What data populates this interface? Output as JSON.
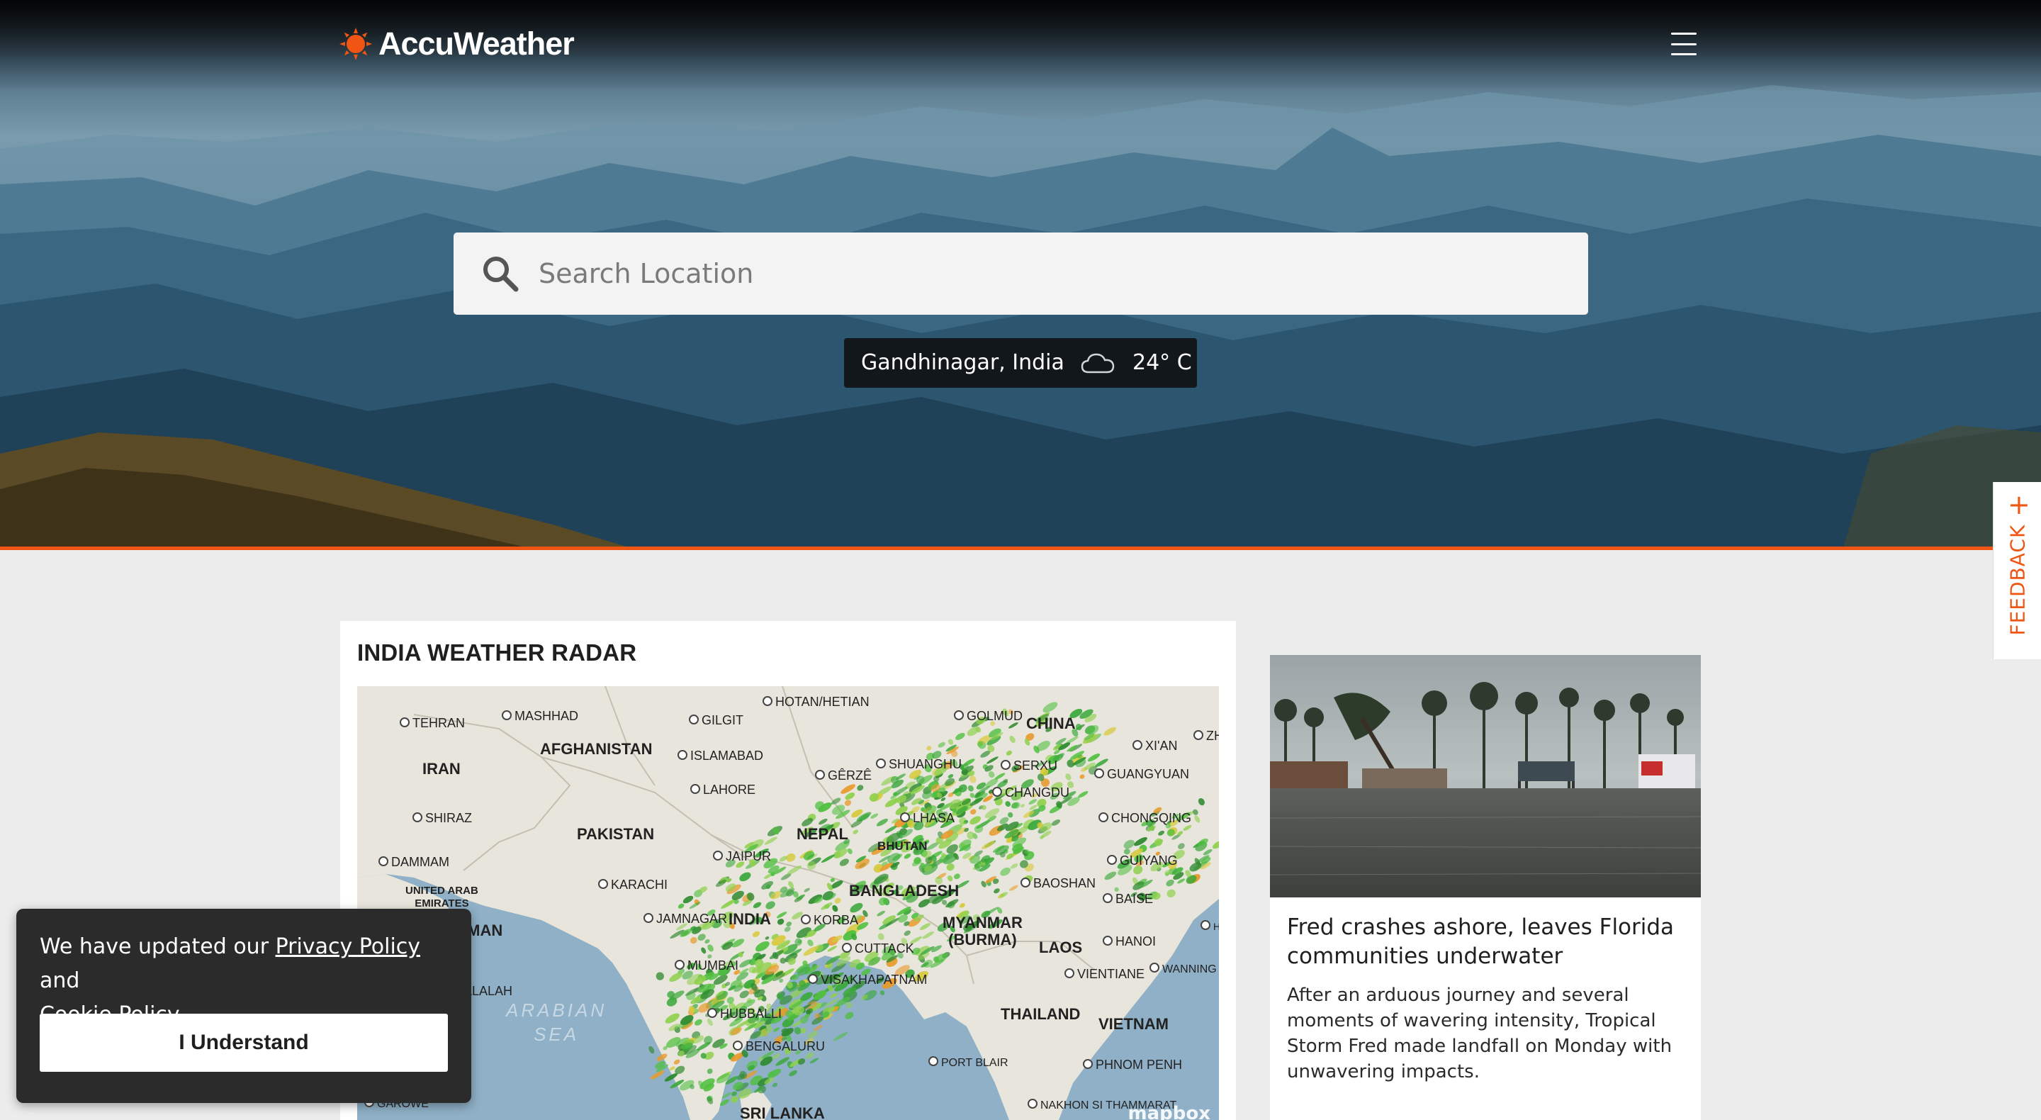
{
  "brand": {
    "name": "AccuWeather",
    "accent_color": "#f05514"
  },
  "header": {
    "menu_icon": "hamburger-menu-icon"
  },
  "search": {
    "placeholder": "Search Location",
    "icon": "search-icon"
  },
  "recent_location": {
    "name": "Gandhinagar, India",
    "condition_icon": "cloud-icon",
    "temperature": "24° C"
  },
  "feedback": {
    "label": "FEEDBACK",
    "plus": "+"
  },
  "radar": {
    "title": "INDIA WEATHER RADAR",
    "countries": [
      "AFGHANISTAN",
      "IRAN",
      "PAKISTAN",
      "NEPAL",
      "BHUTAN",
      "BANGLADESH",
      "INDIA",
      "CHINA",
      "MYANMAR\n(BURMA)",
      "LAOS",
      "THAILAND",
      "VIETNAM",
      "OMAN",
      "SRI LANKA",
      "UNITED ARAB\nEMIRATES"
    ],
    "cities": [
      "TEHRAN",
      "MASHHAD",
      "GILGIT",
      "HOTAN/HETIAN",
      "GOLMUD",
      "ISLAMABAD",
      "SHUANGHU",
      "SERXU",
      "XI'AN",
      "LAHORE",
      "GÊRZÊ",
      "CHANGDU",
      "GUANGYUAN",
      "SHIRAZ",
      "LHASA",
      "CHONGQING",
      "DAMMAM",
      "JAIPUR",
      "GUIYANG",
      "KARACHI",
      "BAOSHAN",
      "BAISE",
      "JAMNAGAR",
      "KORBA",
      "HANOI",
      "CUTTACK",
      "MUMBAI",
      "VIENTIANE",
      "WANNING",
      "VISAKHAPATNAM",
      "SALALAH",
      "HUBBALLI",
      "BENGALURU",
      "PORT BLAIR",
      "PHNOM PENH",
      "GAROWE",
      "NAKHON SI THAMMARAT",
      "ZH",
      "HO"
    ],
    "sea_label": "ARABIAN\nSEA",
    "attribution": "mapbox"
  },
  "news": {
    "title": "Fred crashes ashore, leaves Florida communities underwater",
    "summary": "After an arduous journey and several moments of wavering intensity, Tropical Storm Fred made landfall on Monday with unwavering impacts."
  },
  "cookie_banner": {
    "text_before": "We have updated our ",
    "privacy_link": "Privacy Policy",
    "text_middle": " and",
    "cookie_link": "Cookie Policy",
    "text_after": ".",
    "button_label": "I Understand"
  }
}
